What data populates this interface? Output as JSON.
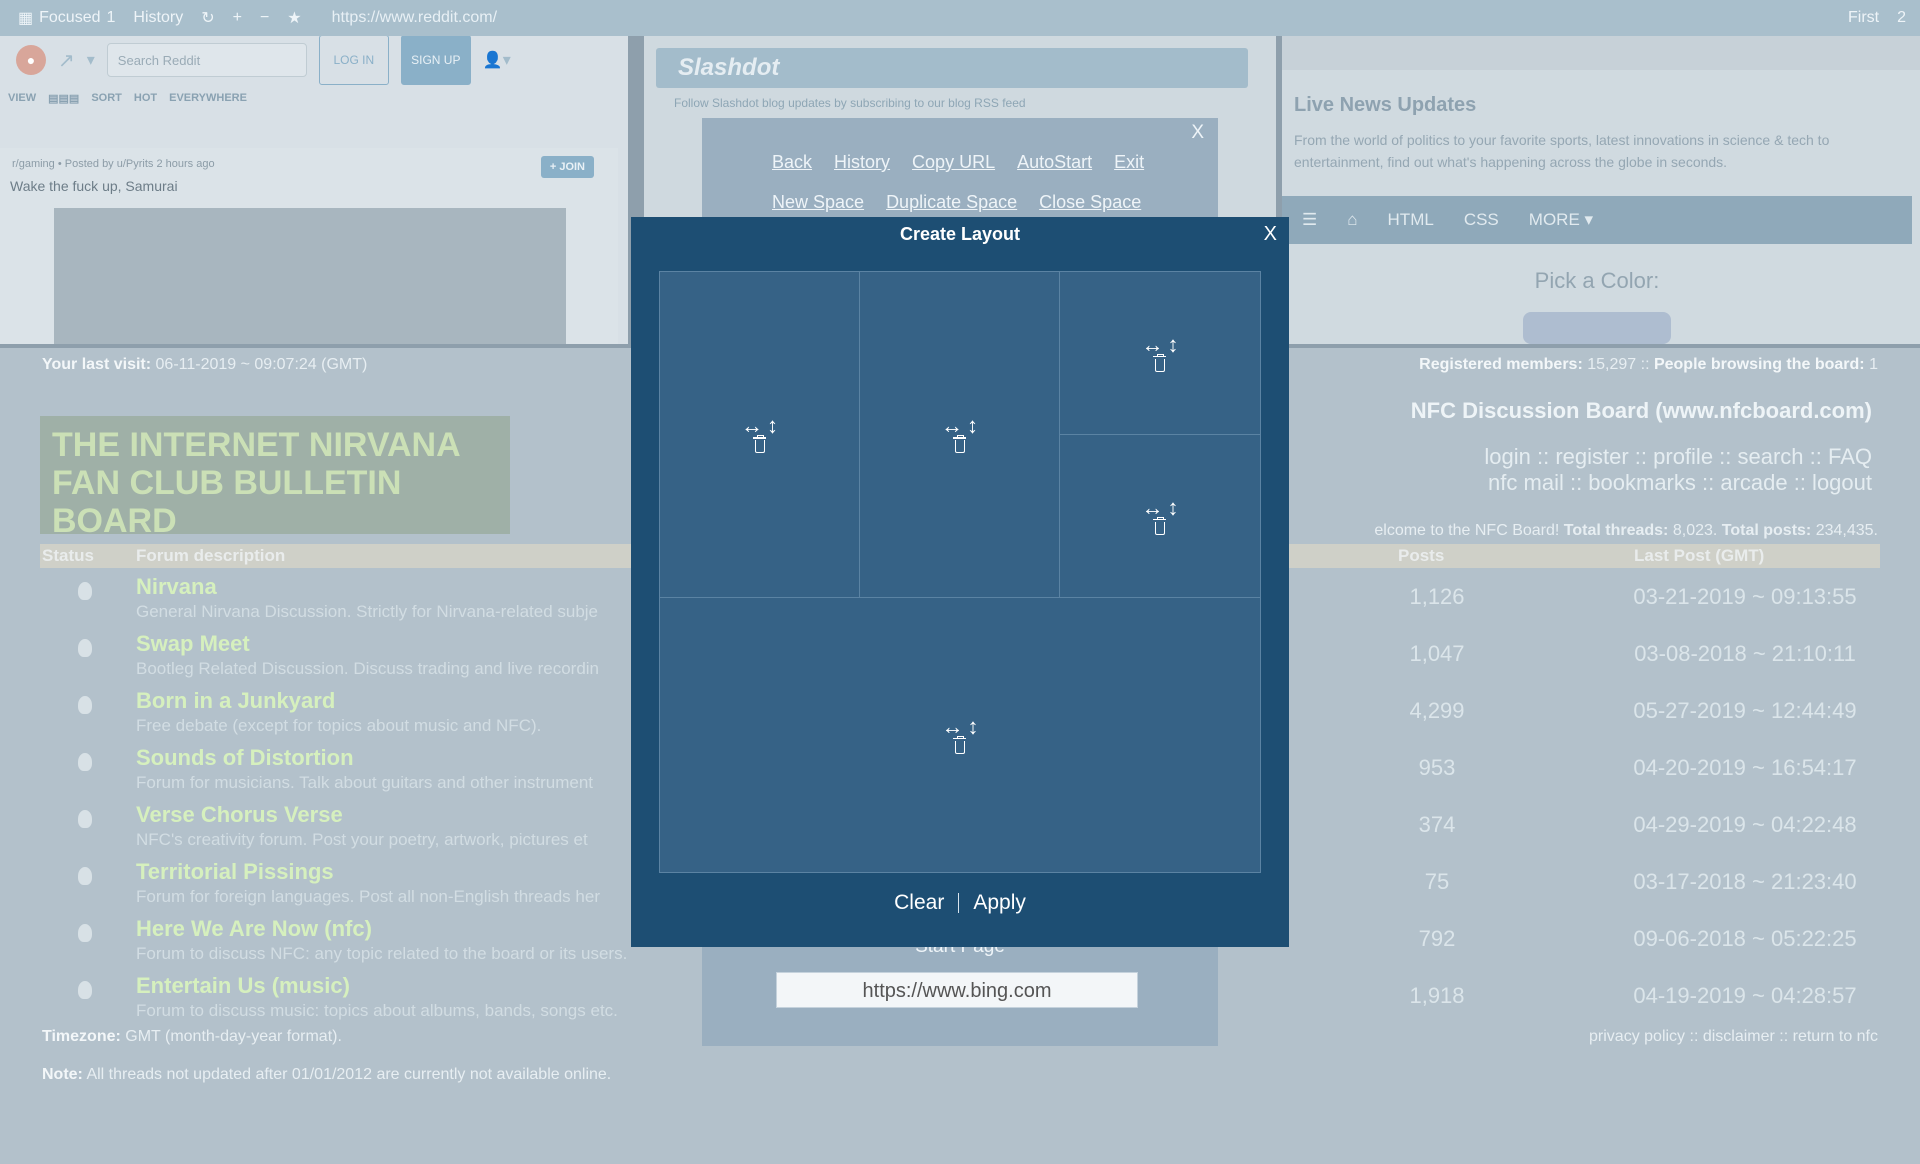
{
  "topbar": {
    "focused_label": "Focused",
    "focused_count": "1",
    "history_label": "History",
    "url": "https://www.reddit.com/",
    "first_label": "First",
    "page_count": "2"
  },
  "reddit": {
    "search_placeholder": "Search Reddit",
    "login_label": "LOG IN",
    "signup_label": "SIGN UP",
    "view_label": "VIEW",
    "sort_label": "SORT",
    "hot_label": "HOT",
    "everywhere_label": "EVERYWHERE",
    "post_meta": "r/gaming • Posted by u/Pyrits 2 hours ago",
    "post_join": "+ JOIN",
    "post_title": "Wake the fuck up, Samurai"
  },
  "slashdot": {
    "logo": "Slashdot",
    "sub_text": "Follow Slashdot blog updates by subscribing to our blog RSS feed"
  },
  "news": {
    "title": "Live News Updates",
    "text": "From the world of politics to your favorite sports, latest innovations in science & tech to entertainment, find out what's happening across the globe in seconds.",
    "nav": [
      "HTML",
      "CSS",
      "MORE ▾"
    ],
    "pick": "Pick a Color:"
  },
  "forum": {
    "last_visit_label": "Your last visit:",
    "last_visit": "06-11-2019 ~ 09:07:24 (GMT)",
    "members_label": "Registered members:",
    "members": "15,297",
    "browsing_label": "People browsing the board:",
    "browsing": "1",
    "board_title": "NFC Discussion Board (www.nfcboard.com)",
    "links1": "login :: register :: profile :: search :: FAQ",
    "links2": "nfc mail :: bookmarks :: arcade :: logout",
    "welcome": "elcome to the NFC Board!",
    "threads_label": "Total threads:",
    "threads": "8,023.",
    "posts_label": "Total posts:",
    "posts": "234,435.",
    "logo_text": "THE INTERNET NIRVANA FAN CLUB BULLETIN BOARD",
    "col_status": "Status",
    "col_desc": "Forum description",
    "col_posts": "Posts",
    "col_last": "Last Post (GMT)",
    "rows": [
      {
        "name": "Nirvana",
        "desc": "General Nirvana Discussion. Strictly for Nirvana-related subje",
        "posts": "1,126",
        "last": "03-21-2019 ~ 09:13:55"
      },
      {
        "name": "Swap Meet",
        "desc": "Bootleg Related Discussion. Discuss trading and live recordin",
        "posts": "1,047",
        "last": "03-08-2018 ~ 21:10:11"
      },
      {
        "name": "Born in a Junkyard",
        "desc": "Free debate (except for topics about music and NFC).",
        "posts": "4,299",
        "last": "05-27-2019 ~ 12:44:49"
      },
      {
        "name": "Sounds of Distortion",
        "desc": "Forum for musicians. Talk about guitars and other instrument",
        "posts": "953",
        "last": "04-20-2019 ~ 16:54:17"
      },
      {
        "name": "Verse Chorus Verse",
        "desc": "NFC's creativity forum. Post your poetry, artwork, pictures et",
        "posts": "374",
        "last": "04-29-2019 ~ 04:22:48"
      },
      {
        "name": "Territorial Pissings",
        "desc": "Forum for foreign languages. Post all non-English threads her",
        "posts": "75",
        "last": "03-17-2018 ~ 21:23:40"
      },
      {
        "name": "Here We Are Now (nfc)",
        "desc": "Forum to discuss NFC: any topic related to the board or its users.",
        "posts": "792",
        "last": "09-06-2018 ~ 05:22:25"
      },
      {
        "name": "Entertain Us (music)",
        "desc": "Forum to discuss music: topics about albums, bands, songs etc.",
        "posts": "1,918",
        "last": "04-19-2019 ~ 04:28:57"
      }
    ],
    "timezone_label": "Timezone:",
    "timezone": "GMT (month-day-year format).",
    "note_label": "Note:",
    "note": "All threads not updated after 01/01/2012 are currently not available online.",
    "footer_links": "privacy policy :: disclaimer :: return to nfc"
  },
  "menu": {
    "close": "X",
    "row1": [
      "Back",
      "History",
      "Copy URL",
      "AutoStart",
      "Exit"
    ],
    "row2": [
      "New Space",
      "Duplicate Space",
      "Close Space"
    ],
    "start_page_label": "Start Page",
    "start_page_url": "https://www.bing.com"
  },
  "modal": {
    "title": "Create Layout",
    "close": "X",
    "clear_label": "Clear",
    "apply_label": "Apply"
  }
}
